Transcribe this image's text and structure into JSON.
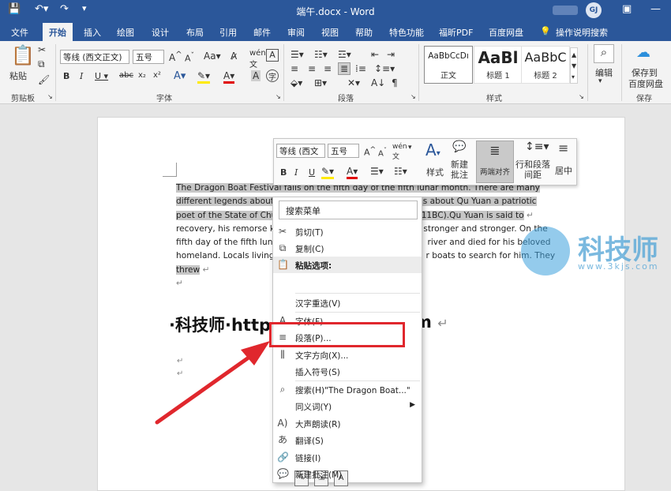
{
  "window": {
    "title": "端午.docx  -  Word",
    "account_initials": "GJ"
  },
  "tabs": [
    "文件",
    "开始",
    "插入",
    "绘图",
    "设计",
    "布局",
    "引用",
    "邮件",
    "审阅",
    "视图",
    "帮助",
    "特色功能",
    "福昕PDF",
    "百度网盘",
    "操作说明搜索"
  ],
  "ribbon": {
    "clipboard": {
      "paste_label": "粘贴",
      "group_label": "剪贴板"
    },
    "font": {
      "font_name": "等线 (西文正文)",
      "font_size": "五号",
      "group_label": "字体"
    },
    "paragraph": {
      "group_label": "段落"
    },
    "styles": {
      "group_label": "样式",
      "items": [
        {
          "preview": "AaBbCcDı",
          "label": "正文"
        },
        {
          "preview": "AaBl",
          "label": "标题 1"
        },
        {
          "preview": "AaBbC",
          "label": "标题 2"
        }
      ]
    },
    "editing": {
      "label": "编辑"
    },
    "save": {
      "label1": "保存到",
      "label2": "百度网盘",
      "group_label": "保存"
    }
  },
  "document": {
    "paragraph_highlighted": "The Dragon Boat Festival falls on the fifth day of the fifth lunar month. There are many different legends about",
    "paragraph_lines": [
      "The Dragon Boat Festival falls on the fifth day of the fifth lunar month. There are many",
      "different legends about",
      "e is about Qu Yuan a patriotic",
      "poet of the State of Chu",
      "5-211BC).Qu Yuan is said to",
      "recovery, his remorse kn",
      "v stronger and stronger. On the",
      "fifth day of the fifth lun",
      "river and died for his beloved",
      "homeland. Locals living",
      "r boats to search for him. They",
      "threw"
    ],
    "heading": "·科技师·http",
    "heading_tail": "m"
  },
  "mini_toolbar": {
    "font_name": "等线 (西文",
    "font_size": "五号",
    "style_label": "样式",
    "new_comment_1": "新建",
    "new_comment_2": "批注",
    "justify_label": "两端对齐",
    "line_spacing_1": "行和段落",
    "line_spacing_2": "间距",
    "center_label": "居中"
  },
  "context_menu": {
    "search_placeholder": "搜索菜单",
    "items": [
      {
        "label": "剪切(T)",
        "icon": "cut-icon"
      },
      {
        "label": "复制(C)",
        "icon": "copy-icon"
      },
      {
        "label": "粘贴选项:",
        "icon": "paste-icon"
      },
      {
        "label": "汉字重选(V)",
        "icon": ""
      },
      {
        "label": "字体(F)...",
        "icon": "font-icon"
      },
      {
        "label": "段落(P)...",
        "icon": "paragraph-icon"
      },
      {
        "label": "文字方向(X)...",
        "icon": "text-direction-icon"
      },
      {
        "label": "插入符号(S)",
        "icon": ""
      },
      {
        "label": "搜索(H)\"The Dragon Boat...\"",
        "icon": "search-icon"
      },
      {
        "label": "同义词(Y)",
        "icon": ""
      },
      {
        "label": "大声朗读(R)",
        "icon": "read-aloud-icon"
      },
      {
        "label": "翻译(S)",
        "icon": "translate-icon"
      },
      {
        "label": "链接(I)",
        "icon": "link-icon"
      },
      {
        "label": "新建批注(M)",
        "icon": "comment-icon"
      }
    ]
  },
  "watermark": {
    "name": "科技师",
    "url": "www.3kjs.com"
  },
  "colors": {
    "brand": "#2b579a",
    "highlight_red": "#e0272d",
    "selection": "#c6c6c6"
  }
}
